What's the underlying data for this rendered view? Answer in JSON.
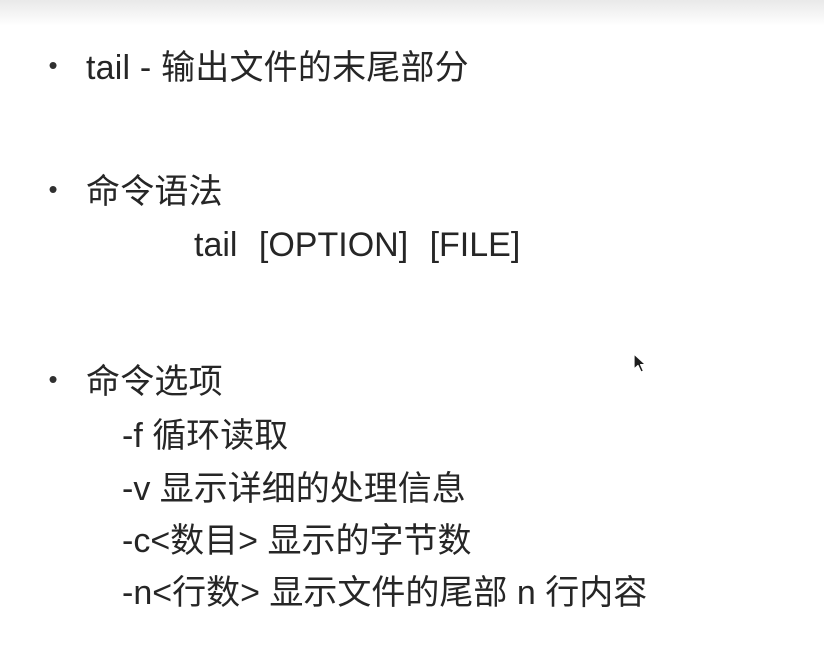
{
  "bullets": [
    {
      "text": "tail - 输出文件的末尾部分"
    },
    {
      "text": "命令语法"
    },
    {
      "text": "命令选项"
    }
  ],
  "syntax": {
    "command": "tail [OPTION]   [FILE]"
  },
  "options": [
    "-f 循环读取",
    "-v 显示详细的处理信息",
    "-c<数目> 显示的字节数",
    "-n<行数> 显示文件的尾部 n 行内容"
  ],
  "icons": {
    "bullet": "bullet-dot",
    "cursor": "mouse-pointer"
  }
}
